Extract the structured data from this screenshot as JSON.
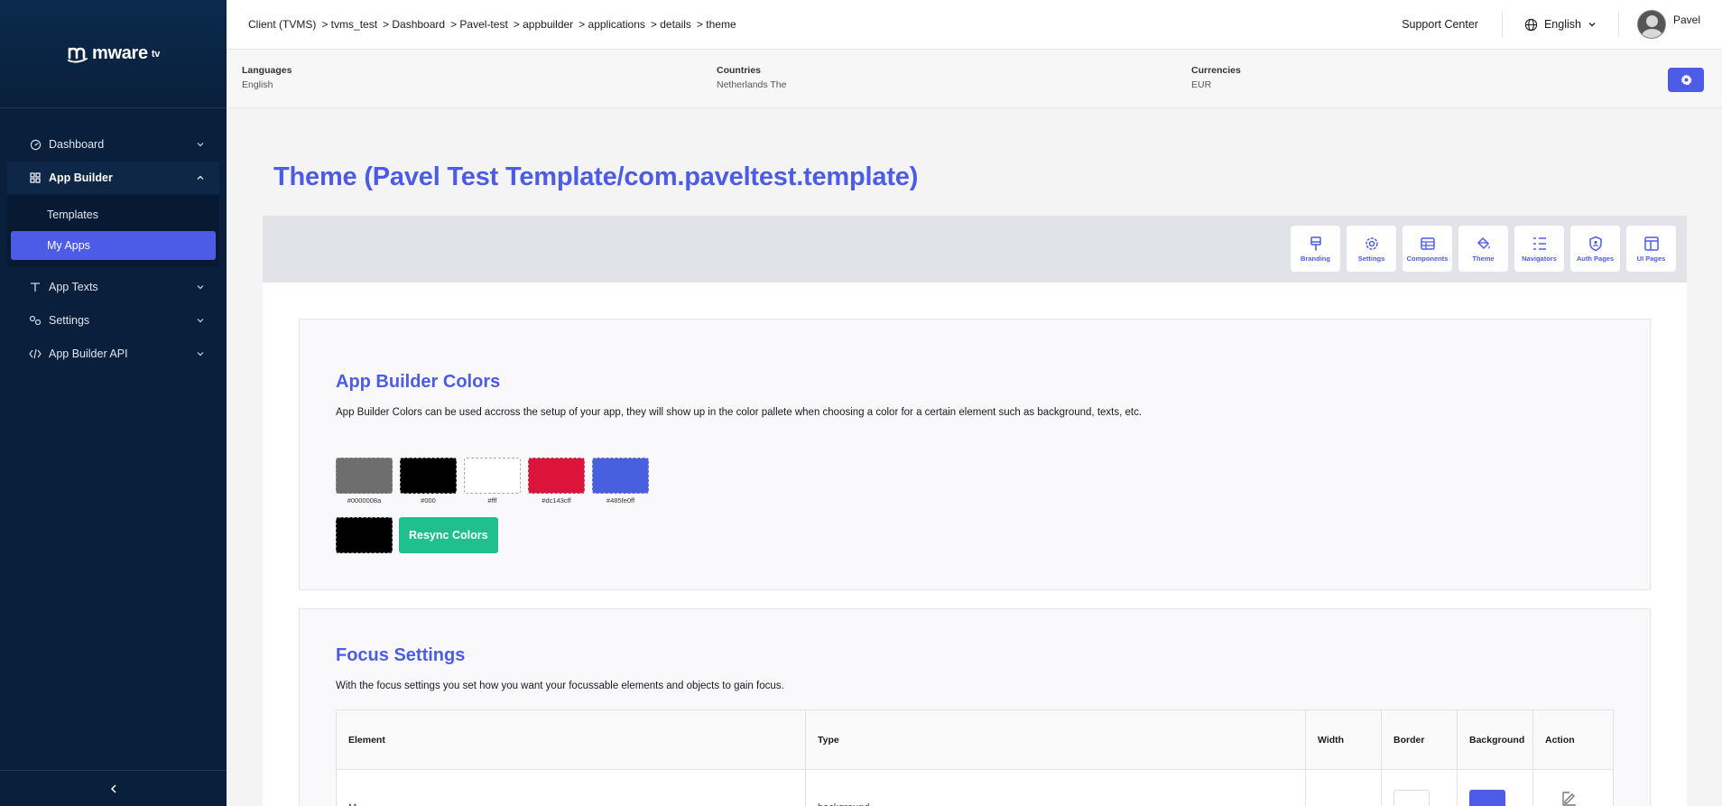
{
  "sidebar": {
    "logo_text": "mware",
    "logo_sup": "tv",
    "items": [
      {
        "label": "Dashboard",
        "icon": "dashboard-icon"
      },
      {
        "label": "App Builder",
        "icon": "grid-icon"
      },
      {
        "label": "App Texts",
        "icon": "text-icon"
      },
      {
        "label": "Settings",
        "icon": "settings-icon"
      },
      {
        "label": "App Builder API",
        "icon": "code-icon"
      }
    ],
    "sub_items": [
      {
        "label": "Templates"
      },
      {
        "label": "My Apps"
      }
    ]
  },
  "topbar": {
    "breadcrumb": [
      "Client (TVMS)",
      "> tvms_test",
      "> Dashboard",
      "> Pavel-test",
      "> appbuilder",
      "> applications",
      "> details",
      "> theme"
    ],
    "support": "Support Center",
    "language": "English",
    "user": "Pavel"
  },
  "info": {
    "languages_label": "Languages",
    "languages_value": "English",
    "countries_label": "Countries",
    "countries_value": "Netherlands The",
    "currencies_label": "Currencies",
    "currencies_value": "EUR"
  },
  "page": {
    "title": "Theme (Pavel Test Template/com.paveltest.template)"
  },
  "toolbar": [
    {
      "label": "Branding",
      "icon": "brush-icon"
    },
    {
      "label": "Settings",
      "icon": "gear-icon"
    },
    {
      "label": "Components",
      "icon": "components-icon"
    },
    {
      "label": "Theme",
      "icon": "paint-bucket-icon"
    },
    {
      "label": "Navigators",
      "icon": "list-tree-icon"
    },
    {
      "label": "Auth Pages",
      "icon": "shield-icon"
    },
    {
      "label": "UI Pages",
      "icon": "layout-icon"
    }
  ],
  "colors_card": {
    "title": "App Builder Colors",
    "description": "App Builder Colors can be used accross the setup of your app, they will show up in the color pallete when choosing a color for a certain element such as background, texts, etc.",
    "swatches": [
      {
        "code": "#0000008a",
        "color": "#6e6e6e"
      },
      {
        "code": "#000",
        "color": "#000000"
      },
      {
        "code": "#fff",
        "color": "#ffffff"
      },
      {
        "code": "#dc143cff",
        "color": "#dc143c"
      },
      {
        "code": "#485fe0ff",
        "color": "#485fe0"
      }
    ],
    "resync_label": "Resync Colors"
  },
  "focus_card": {
    "title": "Focus Settings",
    "description": "With the focus settings you set how you want your focussable elements and objects to gain focus.",
    "columns": [
      "Element",
      "Type",
      "Width",
      "Border",
      "Background",
      "Action"
    ],
    "row": {
      "element": "M",
      "type": "background",
      "border_color": "#ffffff",
      "background_color": "#4d5ce6"
    }
  },
  "colors": {
    "accent": "#4d5ce6",
    "sidebar": "#0a1f3b",
    "success": "#1fc08b"
  }
}
